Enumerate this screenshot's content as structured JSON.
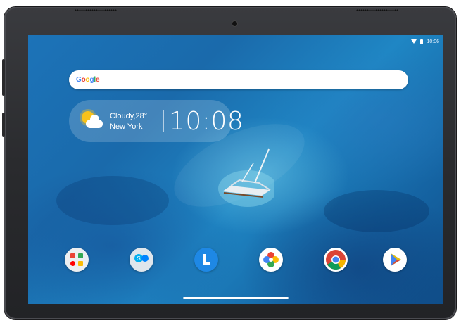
{
  "status_bar": {
    "time": "10:06",
    "icons": [
      "wifi-icon",
      "battery-icon"
    ]
  },
  "search": {
    "logo_text": [
      "G",
      "o",
      "o",
      "g",
      "l",
      "e"
    ]
  },
  "weather_widget": {
    "condition_temp": "Cloudy,28°",
    "city": "New York",
    "time": "10:08",
    "icon": "partly-cloudy-icon"
  },
  "dock": {
    "apps": [
      {
        "name": "google-apps-folder-icon"
      },
      {
        "name": "skype-messenger-folder-icon"
      },
      {
        "name": "lenovo-launcher-icon"
      },
      {
        "name": "photos-icon"
      },
      {
        "name": "chrome-icon"
      },
      {
        "name": "play-store-icon"
      }
    ]
  },
  "colors": {
    "bezel": "#2a2b2e",
    "wallpaper": "#1a6aab"
  }
}
